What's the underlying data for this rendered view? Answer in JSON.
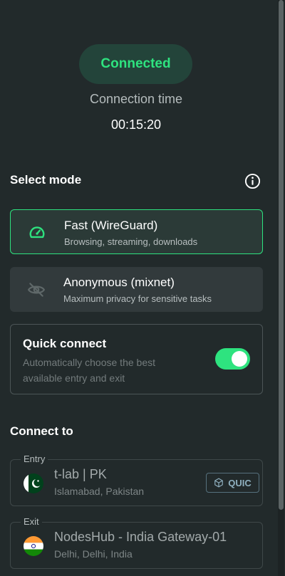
{
  "status": {
    "label": "Connected",
    "time_label": "Connection time",
    "time_value": "00:15:20"
  },
  "mode_section": {
    "title": "Select mode",
    "info_icon": "info-icon",
    "modes": [
      {
        "title": "Fast (WireGuard)",
        "description": "Browsing, streaming, downloads",
        "icon": "speedometer-icon",
        "selected": true
      },
      {
        "title": "Anonymous (mixnet)",
        "description": "Maximum privacy for sensitive tasks",
        "icon": "eye-slash-icon",
        "selected": false
      }
    ]
  },
  "quick_connect": {
    "title": "Quick connect",
    "description": "Automatically choose the best available entry and exit",
    "enabled": true
  },
  "connect_section": {
    "title": "Connect to",
    "entry": {
      "legend": "Entry",
      "name": "t-lab | PK",
      "location": "Islamabad, Pakistan",
      "flag": "pakistan-flag",
      "badge": "QUIC"
    },
    "exit": {
      "legend": "Exit",
      "name": "NodesHub - India Gateway-01",
      "location": "Delhi, Delhi, India",
      "flag": "india-flag"
    }
  },
  "colors": {
    "accent": "#2ee37f",
    "background": "#222a2b",
    "card": "#323a3c"
  }
}
